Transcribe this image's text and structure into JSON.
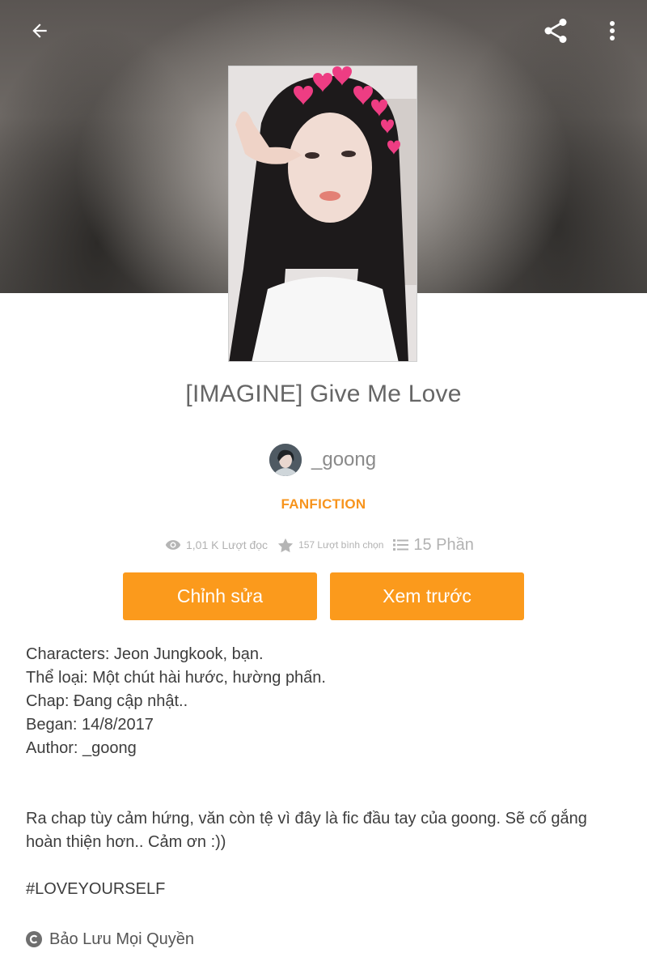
{
  "topbar": {
    "back_icon": "arrow-left-icon",
    "share_icon": "share-icon",
    "more_icon": "more-vertical-icon"
  },
  "story": {
    "title": "[IMAGINE] Give Me Love",
    "author": "_goong",
    "category": "FANFICTION"
  },
  "stats": {
    "reads": "1,01 K Lượt đọc",
    "votes": "157 Lượt bình chọn",
    "parts": "15 Phần"
  },
  "actions": {
    "edit_label": "Chỉnh sửa",
    "preview_label": "Xem trước"
  },
  "description": [
    "Characters: Jeon Jungkook, bạn.",
    "Thể loại: Một chút hài hước, hường phấn.",
    "Chap: Đang cập nhật..",
    "Began: 14/8/2017",
    "Author: _goong",
    "",
    "",
    "Ra chap tùy cảm hứng, văn còn tệ vì đây là fic đầu tay của goong. Sẽ cố gắng hoàn thiện hơn.. Cảm ơn :))",
    "",
    "#LOVEYOURSELF"
  ],
  "copyright": "Bảo Lưu Mọi Quyền",
  "colors": {
    "accent": "#fb9a1c",
    "category": "#f7941d"
  }
}
